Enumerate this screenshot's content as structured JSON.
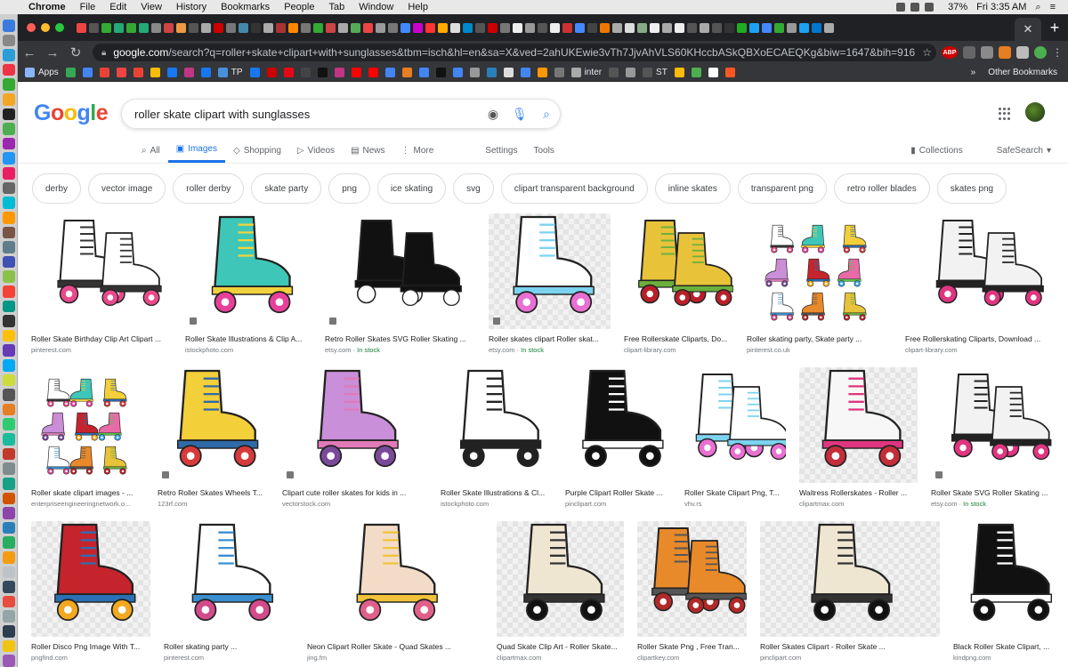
{
  "menubar": {
    "app": "Chrome",
    "menus": [
      "File",
      "Edit",
      "View",
      "History",
      "Bookmarks",
      "People",
      "Tab",
      "Window",
      "Help"
    ],
    "battery": "37%",
    "clock": "Fri 3:35 AM"
  },
  "browser": {
    "url_host": "google.com",
    "url_rest": "/search?q=roller+skate+clipart+with+sunglasses&tbm=isch&hl=en&sa=X&ved=2ahUKEwie3vTh7JjvAhVLS60KHccbASkQBXoECAEQKg&biw=1647&bih=916",
    "bookmarks": [
      {
        "label": "Apps",
        "color": "#8ab4f8"
      },
      {
        "label": "",
        "color": "#34a853"
      },
      {
        "label": "",
        "color": "#4285f4"
      },
      {
        "label": "",
        "color": "#ea4335"
      },
      {
        "label": "",
        "color": "#e44"
      },
      {
        "label": "",
        "color": "#ea4335"
      },
      {
        "label": "",
        "color": "#fbbc05"
      },
      {
        "label": "",
        "color": "#1877f2"
      },
      {
        "label": "",
        "color": "#c13584"
      },
      {
        "label": "",
        "color": "#1877f2"
      },
      {
        "label": "TP",
        "color": "#4a90d9"
      },
      {
        "label": "",
        "color": "#1877f2"
      },
      {
        "label": "",
        "color": "#c00"
      },
      {
        "label": "",
        "color": "#e50914"
      },
      {
        "label": "",
        "color": "#444"
      },
      {
        "label": "",
        "color": "#111"
      },
      {
        "label": "",
        "color": "#c13584"
      },
      {
        "label": "",
        "color": "#ff0000"
      },
      {
        "label": "",
        "color": "#ff0000"
      },
      {
        "label": "",
        "color": "#4285f4"
      },
      {
        "label": "",
        "color": "#e67e22"
      },
      {
        "label": "",
        "color": "#4285f4"
      },
      {
        "label": "",
        "color": "#111"
      },
      {
        "label": "",
        "color": "#4285f4"
      },
      {
        "label": "",
        "color": "#999"
      },
      {
        "label": "",
        "color": "#2980b9"
      },
      {
        "label": "",
        "color": "#ddd"
      },
      {
        "label": "",
        "color": "#4285f4"
      },
      {
        "label": "",
        "color": "#ff9800"
      },
      {
        "label": "",
        "color": "#777"
      },
      {
        "label": "inter",
        "color": "#aaa"
      },
      {
        "label": "",
        "color": "#555"
      },
      {
        "label": "",
        "color": "#999"
      },
      {
        "label": "ST",
        "color": "#555"
      },
      {
        "label": "",
        "color": "#fbbc05"
      },
      {
        "label": "",
        "color": "#4caf50"
      },
      {
        "label": "",
        "color": "#fff"
      },
      {
        "label": "",
        "color": "#ff5722"
      }
    ],
    "other_bookmarks": "Other Bookmarks"
  },
  "google": {
    "logo_letters": [
      "G",
      "o",
      "o",
      "g",
      "l",
      "e"
    ],
    "query": "roller skate clipart with sunglasses",
    "tabs": [
      {
        "label": "All",
        "icon": "search-icon",
        "glyph": "⌕"
      },
      {
        "label": "Images",
        "icon": "images-icon",
        "glyph": "▣",
        "active": true
      },
      {
        "label": "Shopping",
        "icon": "tag-icon",
        "glyph": "◇"
      },
      {
        "label": "Videos",
        "icon": "play-icon",
        "glyph": "▷"
      },
      {
        "label": "News",
        "icon": "news-icon",
        "glyph": "▤"
      },
      {
        "label": "More",
        "icon": "more-icon",
        "glyph": "⋮"
      }
    ],
    "settings": "Settings",
    "tools": "Tools",
    "collections": "Collections",
    "safesearch": "SafeSearch",
    "chips": [
      "derby",
      "vector image",
      "roller derby",
      "skate party",
      "png",
      "ice skating",
      "svg",
      "clipart transparent background",
      "inline skates",
      "transparent png",
      "retro roller blades",
      "skates png"
    ]
  },
  "results": [
    [
      {
        "title": "Roller Skate Birthday Clip Art Clipart ...",
        "source": "pinterest.com",
        "stock": "",
        "style": "white-pink",
        "bg": "plain"
      },
      {
        "title": "Roller Skate Illustrations & Clip A...",
        "source": "istockphoto.com",
        "stock": "",
        "style": "teal-pink",
        "bg": "plain",
        "badge": true
      },
      {
        "title": "Retro Roller Skates SVG Roller Skating ...",
        "source": "etsy.com",
        "stock": "In stock",
        "style": "black",
        "bg": "plain",
        "badge": true
      },
      {
        "title": "Roller skates clipart Roller skat...",
        "source": "etsy.com",
        "stock": "In stock",
        "style": "rainbow",
        "bg": "checker",
        "badge": true
      },
      {
        "title": "Free Rollerskate Cliparts, Do...",
        "source": "clipart-library.com",
        "stock": "",
        "style": "rainbow-red",
        "bg": "plain"
      },
      {
        "title": "Roller skating party, Skate party ...",
        "source": "pinterest.co.uk",
        "stock": "",
        "style": "multi",
        "bg": "plain"
      },
      {
        "title": "Free Rollerskating Cliparts, Download ...",
        "source": "clipart-library.com",
        "stock": "",
        "style": "white-black",
        "bg": "plain"
      }
    ],
    [
      {
        "title": "Roller skate clipart images - ...",
        "source": "enterpriseengineeringnetwork.o...",
        "stock": "",
        "style": "multi",
        "bg": "plain"
      },
      {
        "title": "Retro Roller Skates Wheels T...",
        "source": "123rf.com",
        "stock": "",
        "style": "yellow",
        "bg": "plain",
        "badge": true
      },
      {
        "title": "Clipart cute roller skates for kids in ...",
        "source": "vectorstock.com",
        "stock": "",
        "style": "purple",
        "bg": "plain",
        "badge": true
      },
      {
        "title": "Roller Skate Illustrations & Cl...",
        "source": "istockphoto.com",
        "stock": "",
        "style": "outline",
        "bg": "plain"
      },
      {
        "title": "Purple Clipart Roller Skate ...",
        "source": "pinclipart.com",
        "stock": "",
        "style": "black-solid",
        "bg": "plain"
      },
      {
        "title": "Roller Skate Clipart Png, T...",
        "source": "vhv.rs",
        "stock": "",
        "style": "rainbow",
        "bg": "plain"
      },
      {
        "title": "Waitress Rollerskates - Roller ...",
        "source": "clipartmax.com",
        "stock": "",
        "style": "white-red",
        "bg": "checker"
      },
      {
        "title": "Roller Skate SVG Roller Skating ...",
        "source": "etsy.com",
        "stock": "In stock",
        "style": "white-black",
        "bg": "plain",
        "badge": true
      }
    ],
    [
      {
        "title": "Roller Disco Png Image With T...",
        "source": "pngfind.com",
        "stock": "",
        "style": "red",
        "bg": "checker"
      },
      {
        "title": "Roller skating party ...",
        "source": "pinterest.com",
        "stock": "",
        "style": "white-blue",
        "bg": "plain"
      },
      {
        "title": "Neon Clipart Roller Skate - Quad Skates ...",
        "source": "jing.fm",
        "stock": "",
        "style": "cream",
        "bg": "plain"
      },
      {
        "title": "Quad Skate Clip Art - Roller Skate...",
        "source": "clipartmax.com",
        "stock": "",
        "style": "vintage",
        "bg": "checker"
      },
      {
        "title": "Roller Skate Png , Free Tran...",
        "source": "clipartkey.com",
        "stock": "",
        "style": "orange",
        "bg": "checker"
      },
      {
        "title": "Roller Skates Clipart - Roller Skate ...",
        "source": "pinclipart.com",
        "stock": "",
        "style": "vintage",
        "bg": "checker"
      },
      {
        "title": "Black Roller Skate Clipart, ...",
        "source": "kindpng.com",
        "stock": "",
        "style": "black-solid",
        "bg": "plain"
      }
    ]
  ],
  "palette": {
    "white-pink": [
      "#ffffff",
      "#e84a8a",
      "#333333"
    ],
    "teal-pink": [
      "#3ec7b8",
      "#e8409a",
      "#f2d23c"
    ],
    "black": [
      "#111111",
      "#ffffff",
      "#111111"
    ],
    "rainbow": [
      "#ffffff",
      "#e96fd2",
      "#7bd3f0"
    ],
    "rainbow-red": [
      "#e8c33a",
      "#b8202a",
      "#6bb03c"
    ],
    "multi": [
      "#e86aa8",
      "#35a7e6",
      "#5bc24a"
    ],
    "white-black": [
      "#f2f2f2",
      "#e0357f",
      "#222222"
    ],
    "yellow": [
      "#f3cf3a",
      "#d63a3a",
      "#2f6aa8"
    ],
    "purple": [
      "#c98fd8",
      "#7a4a9a",
      "#e07ab8"
    ],
    "outline": [
      "#ffffff",
      "#222222",
      "#222222"
    ],
    "black-solid": [
      "#111111",
      "#111111",
      "#ffffff"
    ],
    "white-red": [
      "#f7f7f7",
      "#c42e3a",
      "#e0357f"
    ],
    "red": [
      "#c6242c",
      "#f2a81f",
      "#2b6fb5"
    ],
    "white-blue": [
      "#ffffff",
      "#d24b8a",
      "#3a8fd0"
    ],
    "cream": [
      "#f2dcc8",
      "#e0608a",
      "#f2c23a"
    ],
    "vintage": [
      "#efe6d2",
      "#111111",
      "#333333"
    ],
    "orange": [
      "#e8892a",
      "#b02a2a",
      "#555555"
    ]
  }
}
